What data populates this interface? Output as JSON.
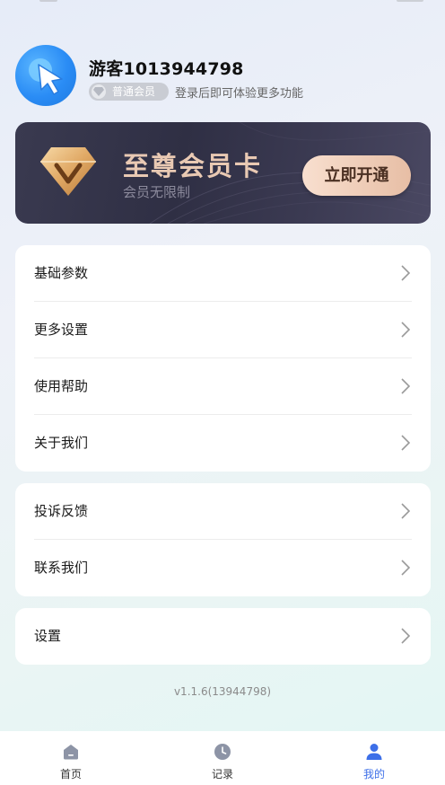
{
  "profile": {
    "username": "游客1013944798",
    "member_badge": "普通会员",
    "login_hint": "登录后即可体验更多功能"
  },
  "vip_card": {
    "title": "至尊会员卡",
    "subtitle": "会员无限制",
    "button": "立即开通",
    "accent": "#e9c9b3"
  },
  "menu_groups": [
    {
      "items": [
        "基础参数",
        "更多设置",
        "使用帮助",
        "关于我们"
      ]
    },
    {
      "items": [
        "投诉反馈",
        "联系我们"
      ]
    },
    {
      "items": [
        "设置"
      ]
    }
  ],
  "version": "v1.1.6(13944798)",
  "tabbar": {
    "items": [
      {
        "label": "首页",
        "icon": "home-icon"
      },
      {
        "label": "记录",
        "icon": "clock-icon"
      },
      {
        "label": "我的",
        "icon": "user-icon"
      }
    ],
    "active_index": 2,
    "active_color": "#3d6fe8"
  }
}
